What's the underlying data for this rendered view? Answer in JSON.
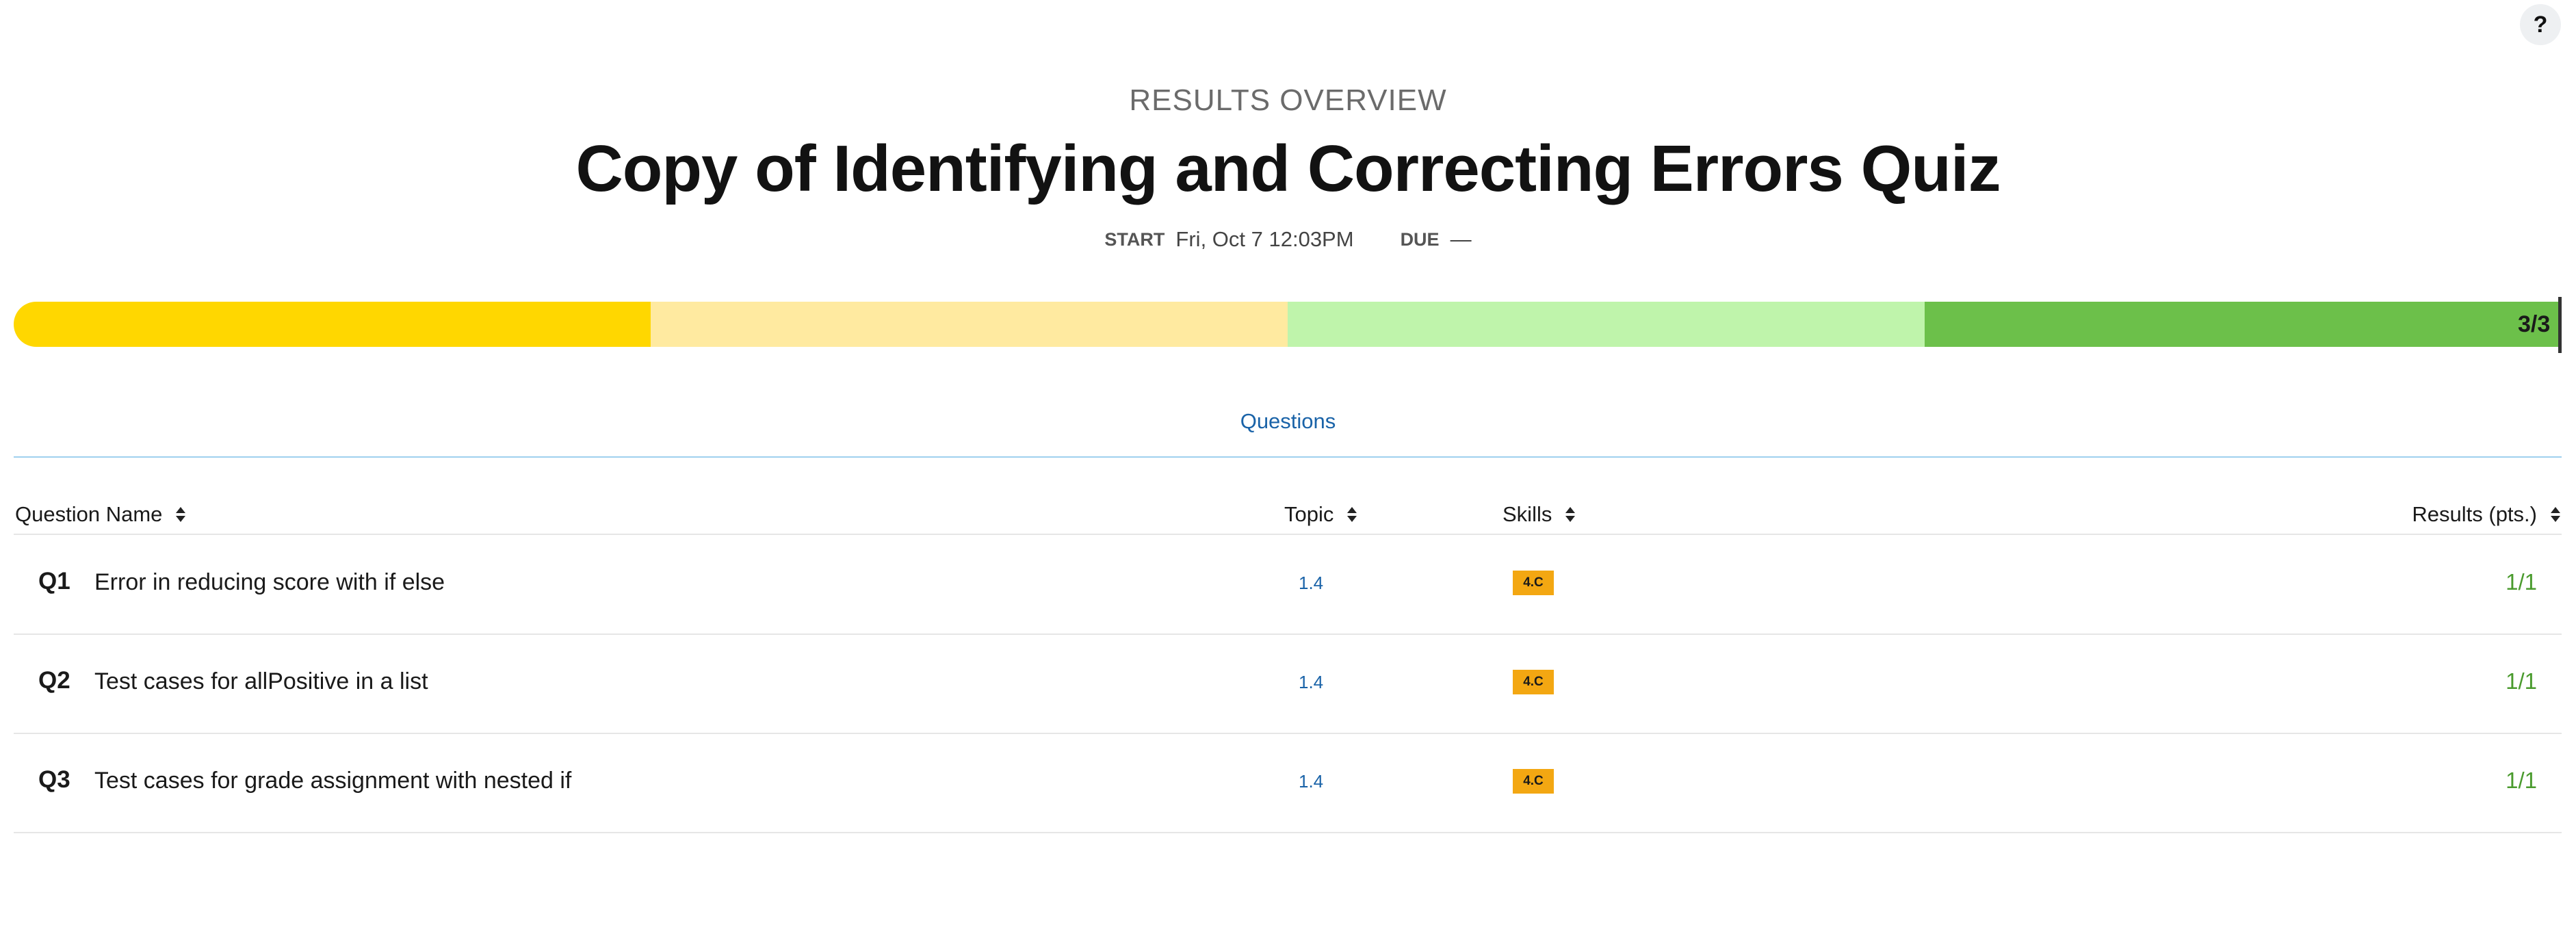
{
  "help": {
    "label": "?"
  },
  "header": {
    "eyebrow": "RESULTS OVERVIEW",
    "title": "Copy of Identifying and Correcting Errors Quiz",
    "start_label": "START",
    "start_value": "Fri, Oct 7 12:03PM",
    "due_label": "DUE",
    "due_value": "—"
  },
  "progress": {
    "label": "3/3",
    "segment_colors": [
      "#ffd700",
      "#ffeaa0",
      "#bff4ab",
      "#6cc04a"
    ]
  },
  "tabs": [
    {
      "label": "Questions"
    }
  ],
  "table": {
    "columns": [
      "Question Name",
      "Topic",
      "Skills",
      "Results (pts.)"
    ],
    "rows": [
      {
        "num": "Q1",
        "name": "Error in reducing score with if else",
        "topic": "1.4",
        "skill": "4.C",
        "result": "1/1"
      },
      {
        "num": "Q2",
        "name": "Test cases for allPositive in a list",
        "topic": "1.4",
        "skill": "4.C",
        "result": "1/1"
      },
      {
        "num": "Q3",
        "name": "Test cases for grade assignment with nested if",
        "topic": "1.4",
        "skill": "4.C",
        "result": "1/1"
      }
    ]
  },
  "colors": {
    "accent_link": "#1a63a8",
    "skill_badge": "#f3a712",
    "result_text": "#4a9b2e"
  }
}
